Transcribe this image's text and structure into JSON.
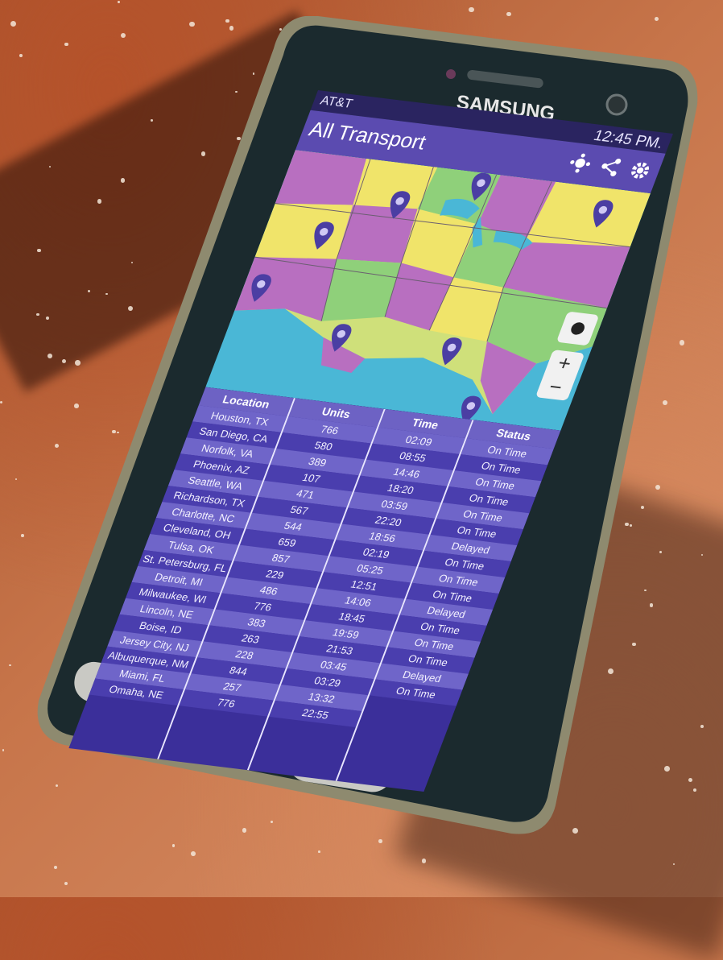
{
  "device": {
    "brand": "SAMSUNG",
    "carrier": "AT&T",
    "time": "12:45 PM."
  },
  "app": {
    "title": "All Transport",
    "icons": [
      "settings-sparkle-icon",
      "share-icon",
      "gear-icon"
    ]
  },
  "map": {
    "zoom_in": "+",
    "zoom_out": "−",
    "pin_count": 8
  },
  "table": {
    "headers": {
      "location": "Location",
      "units": "Units",
      "time": "Time",
      "status": "Status"
    },
    "locations": [
      "Houston, TX",
      "San Diego, CA",
      "Norfolk, VA",
      "Phoenix, AZ",
      "Seattle, WA",
      "Richardson, TX",
      "Charlotte, NC",
      "Cleveland, OH",
      "Tulsa, OK",
      "St. Petersburg, FL",
      "Detroit, MI",
      "Milwaukee, WI",
      "Lincoln, NE",
      "Boise, ID",
      "Jersey City, NJ",
      "Albuquerque, NM",
      "Miami, FL",
      "Omaha, NE"
    ],
    "units": [
      "766",
      "580",
      "389",
      "107",
      "471",
      "567",
      "544",
      "659",
      "857",
      "229",
      "486",
      "776",
      "383",
      "263",
      "228",
      "844",
      "257",
      "776"
    ],
    "times": [
      "02:09",
      "08:55",
      "14:46",
      "18:20",
      "03:59",
      "22:20",
      "18:56",
      "02:19",
      "05:25",
      "12:51",
      "14:06",
      "18:45",
      "19:59",
      "21:53",
      "03:45",
      "03:29",
      "13:32",
      "22:55"
    ],
    "statuses": [
      "On Time",
      "On Time",
      "On Time",
      "On Time",
      "On Time",
      "On Time",
      "Delayed",
      "On Time",
      "On Time",
      "On Time",
      "Delayed",
      "On Time",
      "On Time",
      "On Time",
      "Delayed",
      "On Time"
    ]
  },
  "colors": {
    "status_bar": "#2a2460",
    "app_bar": "#5b4bb0",
    "table_dark": "#4a3eae",
    "table_light": "#6f65c9",
    "water": "#4ab7d6",
    "pin": "#4b3ea3"
  }
}
